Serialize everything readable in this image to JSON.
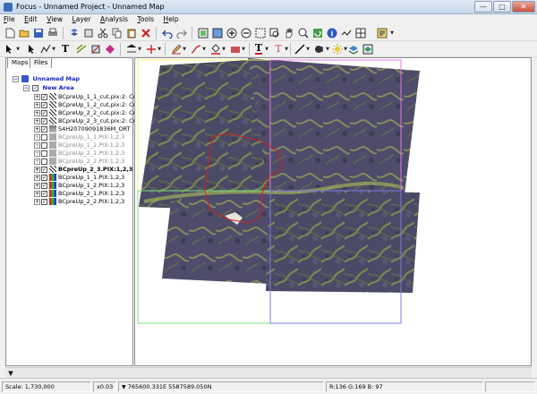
{
  "window": {
    "title": "Focus - Unnamed Project - Unnamed Map",
    "minimize": "—",
    "maximize": "□",
    "close": "✕"
  },
  "menu": [
    {
      "label": "File",
      "key": "F",
      "rest": "ile"
    },
    {
      "label": "Edit",
      "key": "E",
      "rest": "dit"
    },
    {
      "label": "View",
      "key": "V",
      "rest": "iew"
    },
    {
      "label": "Layer",
      "key": "L",
      "rest": "ayer"
    },
    {
      "label": "Analysis",
      "key": "A",
      "rest": "nalysis"
    },
    {
      "label": "Tools",
      "key": "T",
      "rest": "ools"
    },
    {
      "label": "Help",
      "key": "H",
      "rest": "elp"
    }
  ],
  "toolbar1": [
    "new-file-icon",
    "open-folder-icon",
    "save-icon",
    "print-icon",
    "layer-icon",
    "cut-icon",
    "copy-icon",
    "paste-icon",
    "delete-icon",
    "undo-icon",
    "redo-icon",
    "zoom-fit-icon",
    "zoom-extent-icon",
    "zoom-in-icon",
    "zoom-out-icon",
    "zoom-box-icon",
    "pan-icon",
    "zoom-layer-icon",
    "refresh-icon",
    "info-icon",
    "link-icon",
    "grid-icon",
    "settings-icon"
  ],
  "toolbar2": [
    "pointer-icon",
    "arrow-icon",
    "polyline-icon",
    "text-icon",
    "reshape-icon",
    "style-icon",
    "vertex-icon",
    "crosshair-icon",
    "pencil-icon",
    "paint-icon",
    "fill-icon",
    "text-color-icon",
    "font-icon",
    "line-icon",
    "bulb-icon",
    "sun-icon",
    "stack-icon",
    "layers-icon"
  ],
  "panel": {
    "tabs": [
      "Maps",
      "Files"
    ],
    "active_tab": "Maps"
  },
  "tree": [
    {
      "label": "Unnamed Map",
      "level": 0,
      "icon": "map",
      "style": "header",
      "exp": "−"
    },
    {
      "label": "New Area",
      "level": 1,
      "icon": "area",
      "style": "header",
      "exp": "−",
      "chk": "✓"
    },
    {
      "label": "BCpreUp_1_1_cut.pix:2: Cut",
      "level": 2,
      "icon": "vec",
      "style": "",
      "exp": "+",
      "chk": "✓"
    },
    {
      "label": "BCpreUp_1_2_cut.pix:2: Cut",
      "level": 2,
      "icon": "vec",
      "style": "",
      "exp": "+",
      "chk": "✓"
    },
    {
      "label": "BCpreUp_2_2_cut.pix:2: Cut",
      "level": 2,
      "icon": "vec",
      "style": "",
      "exp": "+",
      "chk": "✓"
    },
    {
      "label": "BCpreUp_2_3_cut.pix:2: Cut",
      "level": 2,
      "icon": "vec",
      "style": "",
      "exp": "+",
      "chk": "✓"
    },
    {
      "label": "S4H20709091836M_ORT",
      "level": 2,
      "icon": "ortho",
      "style": "",
      "exp": "+",
      "chk": "✓"
    },
    {
      "label": "BCpreUp_1_1.PIX:1,2,3",
      "level": 2,
      "icon": "gray",
      "style": "dim",
      "exp": "+",
      "chk": ""
    },
    {
      "label": "BCpreUp_1_2.PIX:1,2,3",
      "level": 2,
      "icon": "gray",
      "style": "dim",
      "exp": "+",
      "chk": ""
    },
    {
      "label": "BCpreUp_2_1.PIX:1,2,3",
      "level": 2,
      "icon": "gray",
      "style": "dim",
      "exp": "+",
      "chk": ""
    },
    {
      "label": "BCpreUp_2_2.PIX:1,2,3",
      "level": 2,
      "icon": "gray",
      "style": "dim",
      "exp": "+",
      "chk": ""
    },
    {
      "label": "BCpreUp_2_3.PIX:1,2,3",
      "level": 2,
      "icon": "vec",
      "style": "bold",
      "exp": "+",
      "chk": "✓"
    },
    {
      "label": "BCpreUp_1_1.PIX:1,2,3",
      "level": 2,
      "icon": "rgb",
      "style": "",
      "exp": "+",
      "chk": "✓"
    },
    {
      "label": "BCpreUp_1_2.PIX:1,2,3",
      "level": 2,
      "icon": "rgb",
      "style": "",
      "exp": "+",
      "chk": "✓"
    },
    {
      "label": "BCpreUp_2_1.PIX:1,2,3",
      "level": 2,
      "icon": "rgb",
      "style": "",
      "exp": "+",
      "chk": "✓"
    },
    {
      "label": "BCpreUp_2_2.PIX:1,2,3",
      "level": 2,
      "icon": "rgb",
      "style": "",
      "exp": "+",
      "chk": "✓"
    }
  ],
  "colors": {
    "tile_outline_yellow": "#f0f07a",
    "tile_outline_magenta": "#e878e8",
    "tile_outline_green": "#7ae07a",
    "tile_outline_blue": "#7a7ae0",
    "cut_outline_red": "#d02020",
    "imagery_base": "#4a4a66",
    "vegetation": "#8c9a4a",
    "tree_header": "#1424c8"
  },
  "status": {
    "scale": "Scale: 1,730,000",
    "zoom": "x0.03",
    "coords": "765600.331E 5587589.050N",
    "rgb": "R:136 G:169 B: 97",
    "extra": ""
  }
}
